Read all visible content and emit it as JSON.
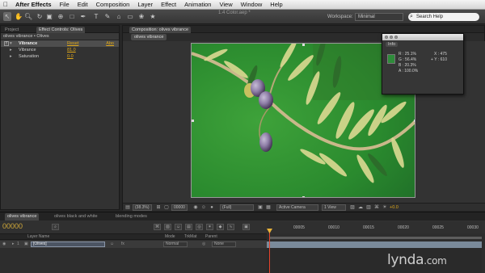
{
  "menubar": {
    "app": "After Effects",
    "items": [
      "File",
      "Edit",
      "Composition",
      "Layer",
      "Effect",
      "Animation",
      "View",
      "Window",
      "Help"
    ]
  },
  "toolbar": {
    "window_title": "1.4 Color.aep *",
    "workspace_label": "Workspace:",
    "workspace_value": "Minimal",
    "search_placeholder": "Search Help"
  },
  "project_panel": {
    "tab_project": "Project",
    "tab_effect_controls": "Effect Controls: Olives",
    "header": "olives vibrance • Olives",
    "effect_name": "Vibrance",
    "reset_label": "Reset",
    "about_label": "Abo",
    "params": [
      {
        "label": "Vibrance",
        "value": "81.0"
      },
      {
        "label": "Saturation",
        "value": "0.0"
      }
    ]
  },
  "composition_panel": {
    "tab_label": "Composition: olives vibrance",
    "subtab_label": "olives vibrance",
    "zoom": "(38.3%)",
    "timecode": "00000",
    "resolution": "(Full)",
    "camera": "Active Camera",
    "views": "1 View",
    "exposure": "+0.0"
  },
  "info_panel": {
    "tab_label": "Info",
    "swatch_color": "#2e8b3a",
    "r": "R : 25.1%",
    "g": "G : 56.4%",
    "b": "B : 20.3%",
    "a": "A : 100.0%",
    "x": "X : 475",
    "y": "+ Y : 610"
  },
  "timeline": {
    "tabs": [
      "olives vibrance",
      "olives black and white",
      "blending modes"
    ],
    "timecode": "00000",
    "column_headers": {
      "layer_name": "Layer Name",
      "mode": "Mode",
      "trkmat": "TrkMat",
      "parent": "Parent"
    },
    "ruler_labels": [
      "00005",
      "00010",
      "00015",
      "00020",
      "00025",
      "00030"
    ],
    "layer": {
      "number": "1",
      "name": "[Olives]",
      "mode": "Normal",
      "parent": "None"
    }
  },
  "watermark": {
    "text": "lynda",
    "suffix": ".com"
  }
}
